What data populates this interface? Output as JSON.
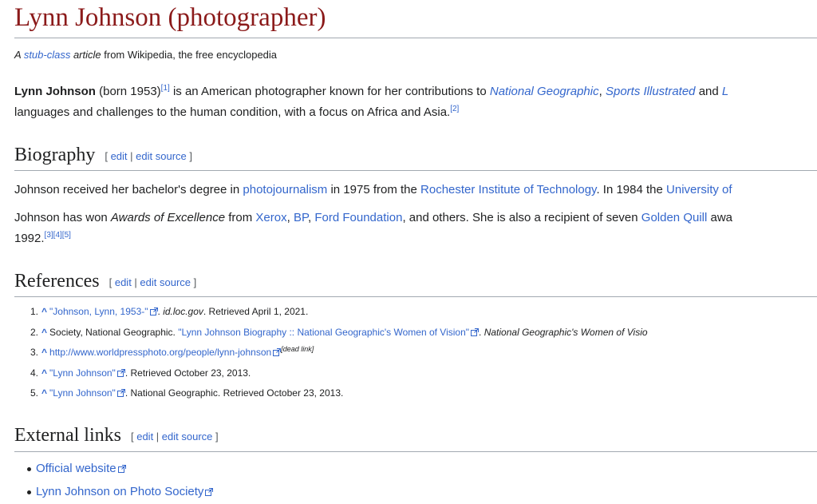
{
  "page": {
    "title": "Lynn Johnson (photographer)",
    "subtitle": {
      "a": "A ",
      "stub_link": "stub-class",
      "b": " article",
      "c": " from Wikipedia, the free encyclopedia"
    }
  },
  "intro": {
    "name": "Lynn Johnson",
    "born": " (born 1953)",
    "cite1": "[1]",
    "text1": " is an American photographer known for her contributions to ",
    "link_ng": "National Geographic",
    "comma1": ", ",
    "link_si": "Sports Illustrated",
    "and": " and ",
    "link_l": "L",
    "line2": "languages and challenges to the human condition, with a focus on Africa and Asia.",
    "cite2": "[2]"
  },
  "sections": {
    "biography": {
      "heading": "Biography"
    },
    "references": {
      "heading": "References"
    },
    "external": {
      "heading": "External links"
    }
  },
  "edit": {
    "open": "[",
    "edit": "edit",
    "sep": " | ",
    "edit_source": "edit source",
    "close": "]"
  },
  "biography": {
    "p1": {
      "t1": "Johnson received her bachelor's degree in ",
      "link_photo": "photojournalism",
      "t2": " in 1975 from the ",
      "link_rit": "Rochester Institute of Technology",
      "t3": ". In 1984 the ",
      "link_uni": "University of"
    },
    "p2": {
      "t1": "Johnson has won ",
      "awards": "Awards of Excellence",
      "t2": " from ",
      "link_xerox": "Xerox",
      "c1": ", ",
      "link_bp": "BP",
      "c2": ", ",
      "link_ford": "Ford Foundation",
      "t3": ", and others. She is also a recipient of seven ",
      "link_golden": "Golden Quill",
      "t4": " awa",
      "year": "1992.",
      "cite3": "[3]",
      "cite4": "[4]",
      "cite5": "[5]"
    }
  },
  "references": [
    {
      "num": "1.",
      "caret": "^",
      "link": "\"Johnson, Lynn, 1953-\"",
      "work": "id.loc.gov",
      "tail": ". Retrieved April 1, 2021."
    },
    {
      "num": "2.",
      "caret": "^",
      "pre": "Society, National Geographic. ",
      "link": "\"Lynn Johnson Biography :: National Geographic's Women of Vision\"",
      "work": "National Geographic's Women of Visio"
    },
    {
      "num": "3.",
      "caret": "^",
      "link": "http://www.worldpressphoto.org/people/lynn-johnson",
      "dead": "[dead link]"
    },
    {
      "num": "4.",
      "caret": "^",
      "link": "\"Lynn Johnson\"",
      "tail": ". Retrieved October 23, 2013."
    },
    {
      "num": "5.",
      "caret": "^",
      "link": "\"Lynn Johnson\"",
      "tail": ". National Geographic. Retrieved October 23, 2013."
    }
  ],
  "external_links": [
    {
      "label": "Official website"
    },
    {
      "label": "Lynn Johnson on Photo Society"
    }
  ],
  "icons": {
    "external": "external-link-icon"
  },
  "colors": {
    "title": "#8b1a1a",
    "link": "#3366cc",
    "rule": "#a2a9b1",
    "text": "#202122"
  }
}
